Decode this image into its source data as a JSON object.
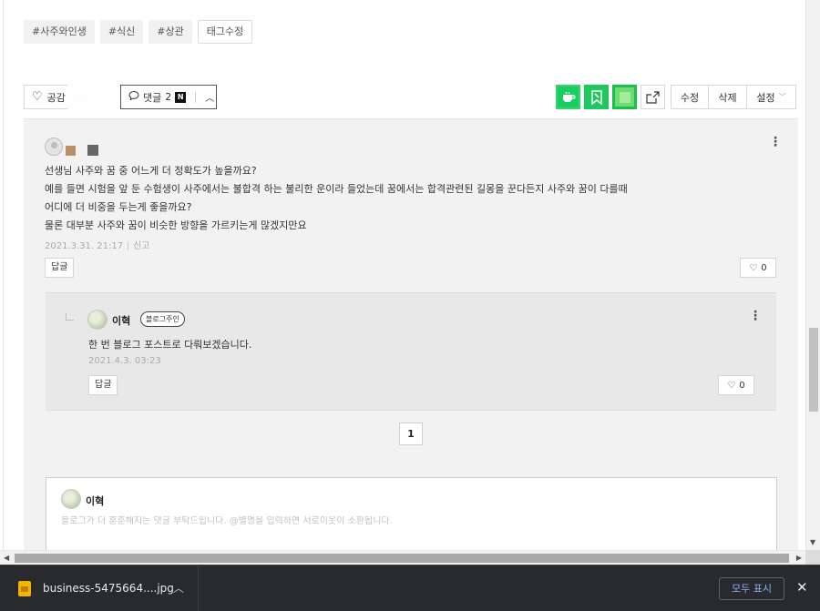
{
  "tags": [
    "#사주와인생",
    "#식신",
    "#상관"
  ],
  "tag_edit_label": "태그수정",
  "actions": {
    "like_label": "공감",
    "comment_label": "댓글",
    "comment_count": "2",
    "naver_badge": "N",
    "edit_label": "수정",
    "delete_label": "삭제",
    "settings_label": "설정"
  },
  "comment": {
    "text_lines": [
      "선생님 사주와 꿈 중 어느게 더 정확도가 높을까요?",
      "예를 들면 시험을 앞 둔 수험생이 사주에서는 불합격 하는 불리한 운이라 들었는데 꿈에서는 합격관련된 길몽을 꾼다든지 사주와 꿈이 다를때",
      "어디에 더 비중을 두는게 좋을까요?",
      "물론 대부분 사주와 꿈이 비슷한 방향을 가르키는게 많겠지만요"
    ],
    "date": "2021.3.31. 21:17",
    "report_label": "신고",
    "reply_label": "답글",
    "like_count": "0"
  },
  "reply": {
    "author": "이혁",
    "badge": "블로그주인",
    "text": "한 번 블로그 포스트로 다뤄보겠습니다.",
    "date": "2021.4.3. 03:23",
    "reply_label": "답글",
    "like_count": "0"
  },
  "pagination": {
    "current": "1"
  },
  "write": {
    "author": "이혁",
    "placeholder": "블로그가 더 훈훈해지는 댓글 부탁드립니다. @별명을 입력하면 서로이웃이 소환됩니다."
  },
  "download_bar": {
    "filename": "business-5475664....jpg",
    "show_all_label": "모두 표시"
  }
}
